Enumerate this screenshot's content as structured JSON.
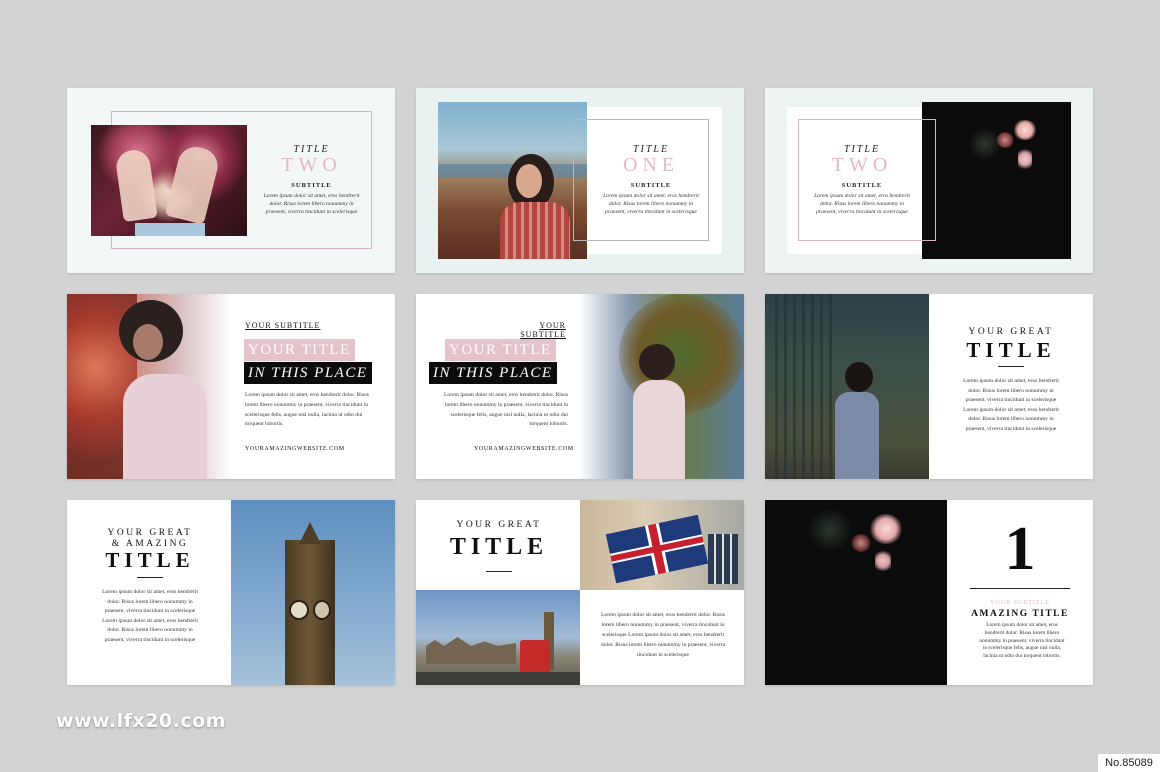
{
  "watermark": "www.lfx20.com",
  "stamp": "No.85089",
  "slides": {
    "s1": {
      "small": "TITLE",
      "big": "TWO",
      "sub": "SUBTITLE",
      "body": "Lorem ipsum dolor sit amet, eros hendrerit dolor. Risus lorem libero nonummy in praesent, viverra tincidunt in scelerisque"
    },
    "s2": {
      "small": "TITLE",
      "big": "ONE",
      "sub": "SUBTITLE",
      "body": "Lorem ipsum dolor sit amet, eros hendrerit dolor. Risus lorem libero nonummy in praesent, viverra tincidunt in scelerisque"
    },
    "s3": {
      "small": "TITLE",
      "big": "TWO",
      "sub": "SUBTITLE",
      "body": "Lorem ipsum dolor sit amet, eros hendrerit dolor. Risus lorem libero nonummy in praesent, viverra tincidunt in scelerisque"
    },
    "s4": {
      "subtitle": "YOUR SUBTITLE",
      "line1": "YOUR TITLE",
      "line2": "IN THIS PLACE",
      "body": "Lorem ipsum dolor sit amet, eros hendrerit dolor. Risus lorem libero nonummy in praesent, viverra tincidunt in scelerisque felis, augue nisl nulla, lacinia ut odio dui torquent lobortis.",
      "website": "YOURAMAZINGWEBSITE.COM"
    },
    "s5": {
      "subtitle": "YOUR SUBTITLE",
      "line1": "YOUR TITLE",
      "line2": "IN THIS PLACE",
      "body": "Lorem ipsum dolor sit amet, eros hendrerit dolor. Risus lorem libero nonummy in praesent, viverra tincidunt in scelerisque felis, augue nisl nulla, lacinia ut odio dui torquent lobortis.",
      "website": "YOURAMAZINGWEBSITE.COM"
    },
    "s6": {
      "great": "YOUR GREAT",
      "title": "TITLE",
      "body": "Lorem ipsum dolor sit amet, eros hendrerit dolor. Risus lorem libero nonummy in praesent, viverra tincidunt in scelerisque Lorem ipsum dolor sit amet, eros hendrerit dolor. Risus lorem libero nonummy in praesent, viverra tincidunt in scelerisque"
    },
    "s7": {
      "great1": "YOUR GREAT",
      "great2": "& AMAZING",
      "title": "TITLE",
      "body": "Lorem ipsum dolor sit amet, eros hendrerit dolor. Risus lorem libero nonummy in praesent, viverra tincidunt in scelerisque Lorem ipsum dolor sit amet, eros hendrerit dolor. Risus lorem libero nonummy in praesent, viverra tincidunt in scelerisque"
    },
    "s8": {
      "great": "YOUR GREAT",
      "title": "TITLE",
      "body": "Lorem ipsum dolor sit amet, eros hendrerit dolor. Risus lorem libero nonummy in praesent, viverra tincidunt in scelerisque Lorem ipsum dolor sit amet, eros hendrerit dolor. Risus lorem libero nonummy in praesent, viverra tincidunt in scelerisque"
    },
    "s9": {
      "number": "1",
      "subtitle": "YOUR SUBTITLE",
      "title": "AMAZING TITLE",
      "body": "Lorem ipsum dolor sit amet, eros hendrerit dolor. Risus lorem libero nonummy in praesent, viverra tincidunt in scelerisque felis, augue nisl nulla, lacinia ut odio dui torquent lobortis."
    }
  },
  "colors": {
    "pink": "#e2b9c2",
    "black": "#0c0c0c",
    "background": "#d3d3d3"
  }
}
